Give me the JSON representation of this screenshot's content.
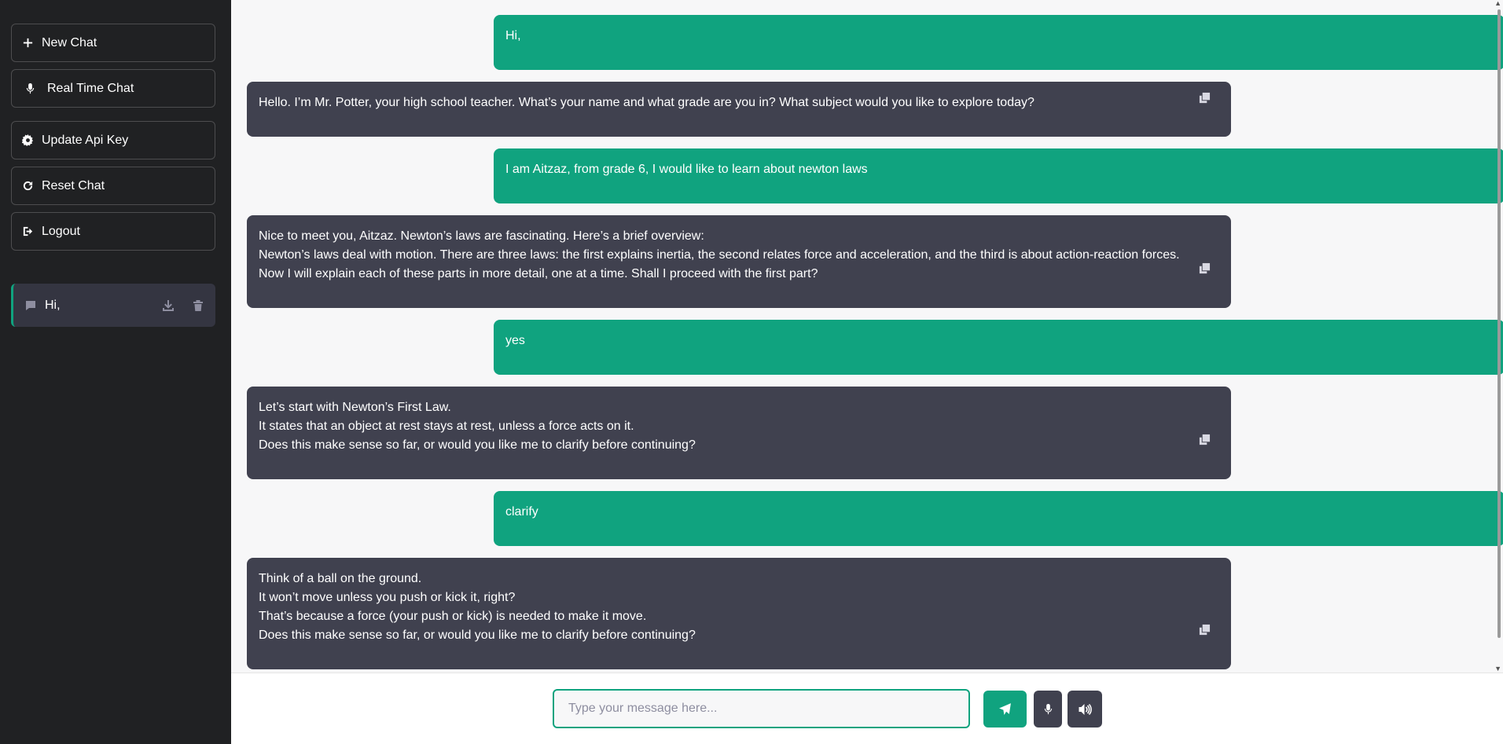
{
  "sidebar": {
    "new_chat": "New Chat",
    "real_time_chat": "Real Time Chat",
    "update_api_key": "Update Api Key",
    "reset_chat": "Reset Chat",
    "logout": "Logout",
    "conversations": [
      {
        "title": "Hi,"
      }
    ]
  },
  "messages": [
    {
      "role": "user",
      "lines": [
        "Hi,"
      ]
    },
    {
      "role": "assistant",
      "lines": [
        "Hello. I’m Mr. Potter, your high school teacher. What’s your name and what grade are you in? What subject would you like to explore today?"
      ]
    },
    {
      "role": "user",
      "lines": [
        "I am Aitzaz, from grade 6, I would like to learn about newton laws"
      ]
    },
    {
      "role": "assistant",
      "lines": [
        "Nice to meet you, Aitzaz. Newton’s laws are fascinating. Here’s a brief overview:",
        "Newton’s laws deal with motion. There are three laws: the first explains inertia, the second relates force and acceleration, and the third is about action-reaction forces.",
        "Now I will explain each of these parts in more detail, one at a time. Shall I proceed with the first part?"
      ]
    },
    {
      "role": "user",
      "lines": [
        "yes"
      ]
    },
    {
      "role": "assistant",
      "lines": [
        "Let’s start with Newton’s First Law.",
        "It states that an object at rest stays at rest, unless a force acts on it.",
        "Does this make sense so far, or would you like me to clarify before continuing?"
      ]
    },
    {
      "role": "user",
      "lines": [
        "clarify"
      ]
    },
    {
      "role": "assistant",
      "lines": [
        "Think of a ball on the ground.",
        "It won’t move unless you push or kick it, right?",
        "That’s because a force (your push or kick) is needed to make it move.",
        "Does this make sense so far, or would you like me to clarify before continuing?"
      ]
    }
  ],
  "input": {
    "placeholder": "Type your message here...",
    "value": ""
  },
  "icons": {
    "new_chat": "plus-icon",
    "real_time_chat": "microphone-icon",
    "update_api_key": "gear-icon",
    "reset_chat": "refresh-icon",
    "logout": "logout-icon",
    "conversation": "chat-bubble-icon",
    "download": "download-icon",
    "delete": "trash-icon",
    "copy": "copy-icon",
    "send": "paper-plane-icon",
    "mic": "microphone-icon",
    "volume": "volume-icon"
  },
  "colors": {
    "sidebar_bg": "#202123",
    "accent": "#10a37f",
    "assistant_bubble": "#40414f",
    "chat_bg": "#f7f7f8"
  }
}
